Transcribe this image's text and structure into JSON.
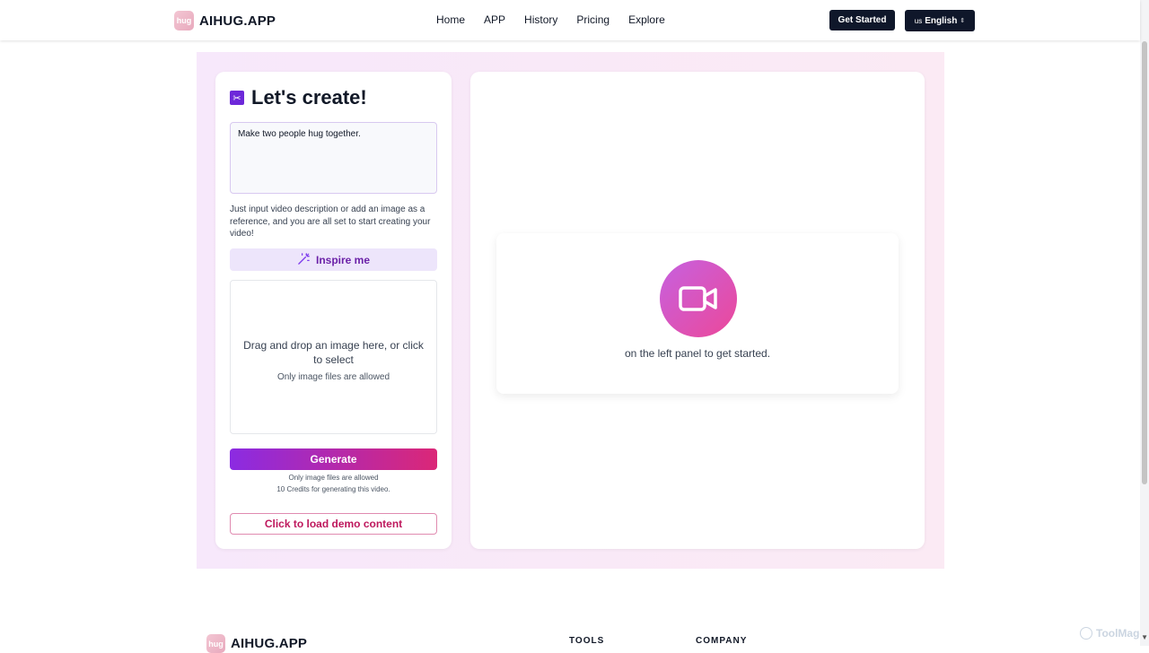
{
  "header": {
    "logo_mark": "hug",
    "logo_text": "AIHUG.APP",
    "nav": [
      "Home",
      "APP",
      "History",
      "Pricing",
      "Explore"
    ],
    "get_started": "Get Started",
    "lang_flag": "us",
    "lang_label": "English",
    "lang_caret": "⇕"
  },
  "left_panel": {
    "title": "Let's create!",
    "prompt_value": "Make two people hug together.",
    "hint": "Just input video description or add an image as a reference, and you are all set to start creating your video!",
    "inspire_label": "Inspire me",
    "dropzone_main": "Drag and drop an image here, or click to select",
    "dropzone_sub": "Only image files are allowed",
    "generate_label": "Generate",
    "note_allowed": "Only image files are allowed",
    "note_credits": "10 Credits for generating this video.",
    "demo_label": "Click to load demo content"
  },
  "right_panel": {
    "placeholder_text": "on the left panel to get started."
  },
  "footer": {
    "logo_mark": "hug",
    "logo_text": "AIHUG.APP",
    "tools_heading": "TOOLS",
    "company_heading": "COMPANY"
  },
  "watermark": "ToolMage",
  "colors": {
    "accent_purple": "#8b2be2",
    "accent_pink": "#db2777",
    "dark_button": "#0f172a"
  }
}
